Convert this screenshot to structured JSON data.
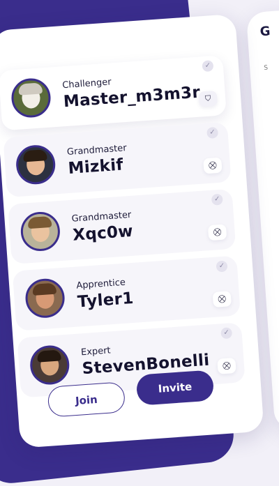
{
  "players": [
    {
      "rank": "Challenger",
      "name": "Master_m3m3r",
      "check": "✓",
      "action_icon": "shield-icon",
      "action_glyph": "⛉",
      "avatar_face": "#f2efe8",
      "avatar_hair": "#cfcac0",
      "avatar_bg": "#5a6b3a",
      "highlighted": true
    },
    {
      "rank": "Grandmaster",
      "name": "Mizkif",
      "check": "✓",
      "action_icon": "remove-user-icon",
      "action_glyph": "⛒",
      "avatar_face": "#e6b894",
      "avatar_hair": "#2a1d12",
      "avatar_bg": "#2c3140",
      "highlighted": false
    },
    {
      "rank": "Grandmaster",
      "name": "Xqc0w",
      "check": "✓",
      "action_icon": "remove-user-icon",
      "action_glyph": "⛒",
      "avatar_face": "#eac39f",
      "avatar_hair": "#7a5a34",
      "avatar_bg": "#b9b39a",
      "highlighted": false
    },
    {
      "rank": "Apprentice",
      "name": "Tyler1",
      "check": "✓",
      "action_icon": "remove-user-icon",
      "action_glyph": "⛒",
      "avatar_face": "#d89a75",
      "avatar_hair": "#5a3a22",
      "avatar_bg": "#8a6a50",
      "highlighted": false
    },
    {
      "rank": "Expert",
      "name": "StevenBonelli",
      "check": "✓",
      "action_icon": "remove-user-icon",
      "action_glyph": "⛒",
      "avatar_face": "#d9a77e",
      "avatar_hair": "#241810",
      "avatar_bg": "#4a3b36",
      "highlighted": false
    }
  ],
  "buttons": {
    "join": "Join",
    "invite": "Invite"
  },
  "side_card": {
    "title_fragment": "G",
    "label_fragment": "S"
  },
  "colors": {
    "accent": "#3a2d8c",
    "background": "#f2f0f8"
  }
}
